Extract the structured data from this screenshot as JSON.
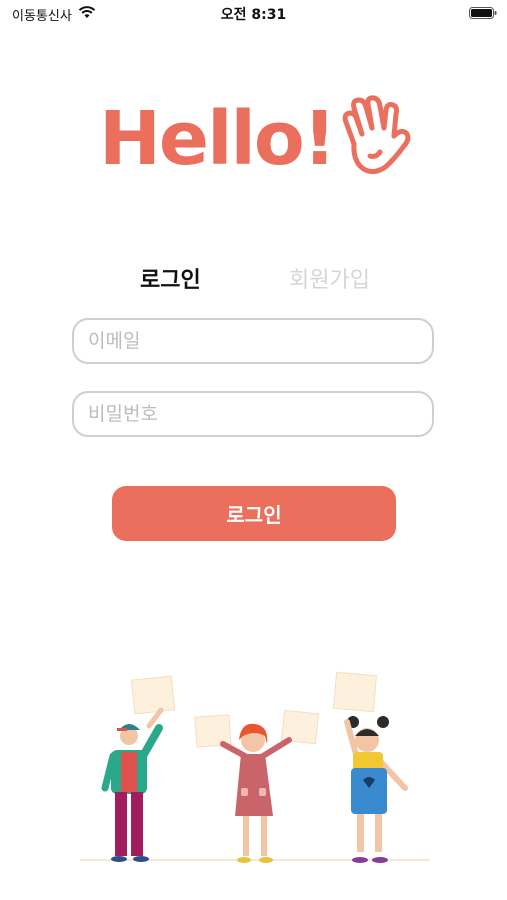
{
  "status_bar": {
    "carrier": "이동통신사",
    "time": "오전 8:31"
  },
  "logo": {
    "text": "Hello!",
    "icon": "waving-hand-icon",
    "color": "#ea6f5d"
  },
  "tabs": {
    "login": "로그인",
    "signup": "회원가입"
  },
  "form": {
    "email_placeholder": "이메일",
    "password_placeholder": "비밀번호",
    "email_value": "",
    "password_value": ""
  },
  "login_button": {
    "label": "로그인",
    "color": "#ea6f5d"
  },
  "illustration": {
    "description_icon": "kids-holding-signs-illustration"
  }
}
